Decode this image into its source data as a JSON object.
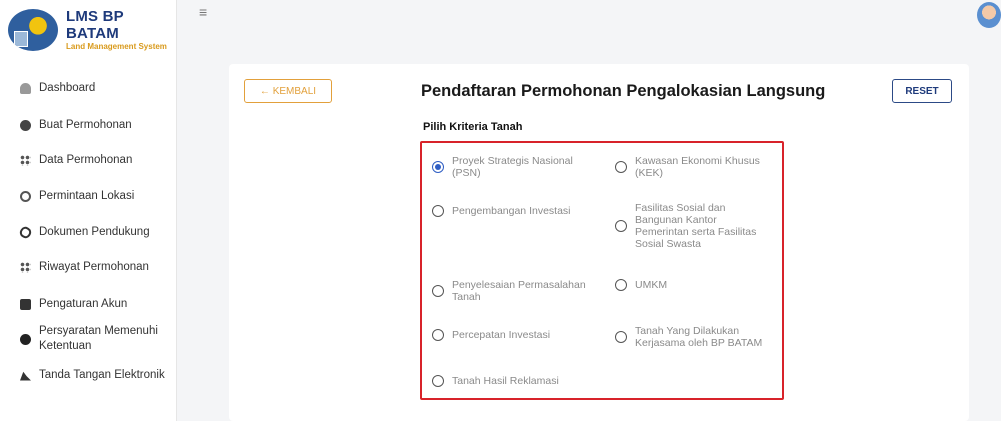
{
  "brand": {
    "title": "LMS BP BATAM",
    "subtitle": "Land Management System"
  },
  "sidebar": {
    "items": [
      {
        "label": "Dashboard",
        "icon": "house-icon"
      },
      {
        "label": "Buat Permohonan",
        "icon": "globe-icon"
      },
      {
        "label": "Data Permohonan",
        "icon": "dots-icon"
      },
      {
        "label": "Permintaan Lokasi",
        "icon": "location-icon"
      },
      {
        "label": "Dokumen Pendukung",
        "icon": "paperclip-icon"
      },
      {
        "label": "Riwayat Permohonan",
        "icon": "dots-icon"
      },
      {
        "label": "Pengaturan Akun",
        "icon": "card-icon"
      },
      {
        "label": "Persyaratan Memenuhi\nKetentuan",
        "icon": "check-circle-icon"
      },
      {
        "label": "Tanda Tangan Elektronik",
        "icon": "signature-icon"
      }
    ]
  },
  "header": {
    "menu_icon": "≡"
  },
  "main": {
    "back_label": "← KEMBALI",
    "title": "Pendaftaran Permohonan Pengalokasian Langsung",
    "reset_label": "RESET",
    "section_label": "Pilih Kriteria Tanah",
    "options": [
      {
        "label": "Proyek Strategis Nasional\n(PSN)",
        "checked": true
      },
      {
        "label": "Kawasan Ekonomi Khusus\n(KEK)",
        "checked": false
      },
      {
        "label": "Pengembangan Investasi",
        "checked": false
      },
      {
        "label": "Fasilitas Sosial dan\nBangunan Kantor\nPemerintan serta Fasilitas\nSosial Swasta",
        "checked": false
      },
      {
        "label": "Penyelesaian Permasalahan\nTanah",
        "checked": false
      },
      {
        "label": "UMKM",
        "checked": false
      },
      {
        "label": "Percepatan Investasi",
        "checked": false
      },
      {
        "label": "Tanah Yang Dilakukan\nKerjasama oleh BP BATAM",
        "checked": false
      },
      {
        "label": "Tanah Hasil Reklamasi",
        "checked": false
      }
    ]
  },
  "colors": {
    "accent_orange": "#e2a03b",
    "brand_navy": "#1e3a7b",
    "highlight_red": "#d8232a",
    "radio_selected": "#2f5ec4"
  }
}
